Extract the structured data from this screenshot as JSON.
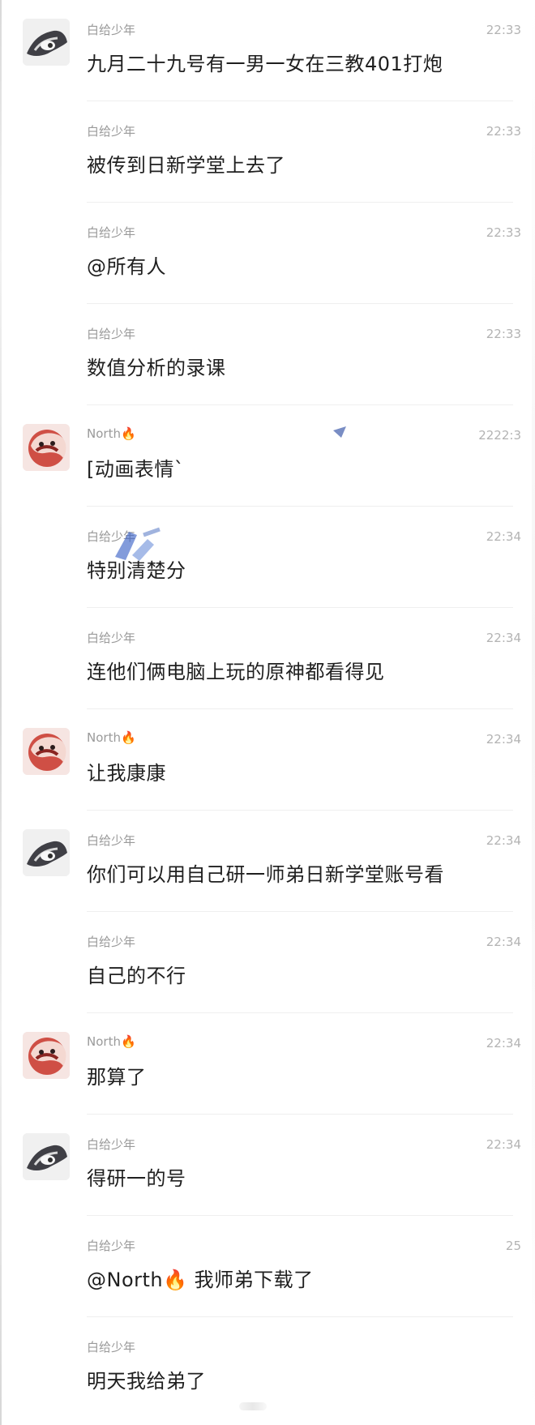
{
  "messages": [
    {
      "id": 1,
      "sender": "白给少年",
      "time": "22:33",
      "text": "九月二十九号有一男一女在三教401打炮",
      "avatar": "dark-sketch-avatar-icon",
      "show_avatar": true
    },
    {
      "id": 2,
      "sender": "白给少年",
      "time": "22:33",
      "text": "被传到日新学堂上去了",
      "avatar": "",
      "show_avatar": false
    },
    {
      "id": 3,
      "sender": "白给少年",
      "time": "22:33",
      "text": "@所有人",
      "avatar": "",
      "show_avatar": false
    },
    {
      "id": 4,
      "sender": "白给少年",
      "time": "22:33",
      "text": "数值分析的录课",
      "avatar": "",
      "show_avatar": false
    },
    {
      "id": 5,
      "sender": "North🔥",
      "time": "2222:3",
      "text": "[动画表情`",
      "avatar": "red-cartoon-avatar-icon",
      "show_avatar": true
    },
    {
      "id": 6,
      "sender": "白给少年",
      "time": "22:34",
      "text": "特别清楚分",
      "avatar": "",
      "show_avatar": false
    },
    {
      "id": 7,
      "sender": "白给少年",
      "time": "22:34",
      "text": "连他们俩电脑上玩的原神都看得见",
      "avatar": "",
      "show_avatar": false
    },
    {
      "id": 8,
      "sender": "North🔥",
      "time": "22:34",
      "text": "让我康康",
      "avatar": "red-cartoon-avatar-icon",
      "show_avatar": true
    },
    {
      "id": 9,
      "sender": "白给少年",
      "time": "22:34",
      "text": "你们可以用自己研一师弟日新学堂账号看",
      "avatar": "dark-sketch-avatar-icon",
      "show_avatar": true
    },
    {
      "id": 10,
      "sender": "白给少年",
      "time": "22:34",
      "text": "自己的不行",
      "avatar": "",
      "show_avatar": false
    },
    {
      "id": 11,
      "sender": "North🔥",
      "time": "22:34",
      "text": "那算了",
      "avatar": "red-cartoon-avatar-icon",
      "show_avatar": true
    },
    {
      "id": 12,
      "sender": "白给少年",
      "time": "22:34",
      "text": "得研一的号",
      "avatar": "dark-sketch-avatar-icon",
      "show_avatar": true
    },
    {
      "id": 13,
      "sender": "白给少年",
      "time": "25",
      "text": "@North🔥 我师弟下载了",
      "avatar": "",
      "show_avatar": false
    },
    {
      "id": 14,
      "sender": "白给少年",
      "time": "",
      "text": "明天我给弟了",
      "avatar": "",
      "show_avatar": false
    }
  ]
}
